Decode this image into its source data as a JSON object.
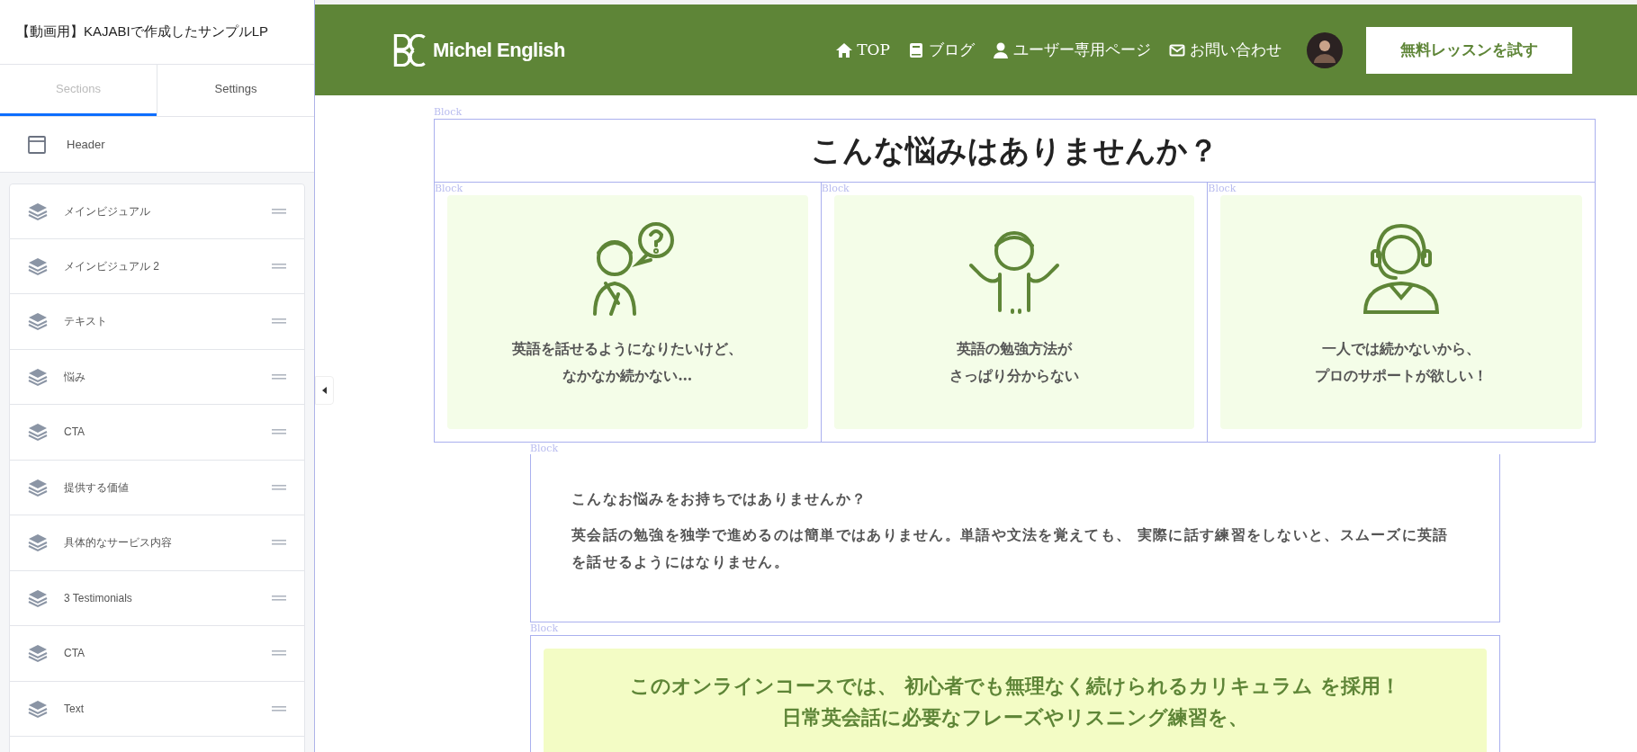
{
  "sidebar": {
    "title": "【動画用】KAJABIで作成したサンプルLP",
    "tabs": [
      {
        "label": "Sections",
        "selected": true
      },
      {
        "label": "Settings",
        "selected": false
      }
    ],
    "header_item": "Header",
    "sections": [
      "メインビジュアル",
      "メインビジュアル 2",
      "テキスト",
      "悩み",
      "CTA",
      "提供する価値",
      "具体的なサービス内容",
      "3 Testimonials",
      "CTA",
      "Text"
    ]
  },
  "site_header": {
    "logo": "Michel English",
    "nav": [
      {
        "kind": "home",
        "label": "TOP"
      },
      {
        "kind": "book",
        "label": "ブログ"
      },
      {
        "kind": "user",
        "label": "ユーザー専用ページ"
      },
      {
        "kind": "mail",
        "label": "お問い合わせ"
      }
    ],
    "cta": "無料レッスンを試す"
  },
  "problems": {
    "block_label": "Block",
    "title": "こんな悩みはありませんか？",
    "cards": [
      {
        "block_label": "Block",
        "kind": "question",
        "lines": [
          "英語を話せるようになりたいけど、",
          "なかなか続かない…"
        ]
      },
      {
        "block_label": "Block",
        "kind": "shrug",
        "lines": [
          "英語の勉強方法が",
          "さっぱり分からない"
        ]
      },
      {
        "block_label": "Block",
        "kind": "headset",
        "lines": [
          "一人では続かないから、",
          "プロのサポートが欲しい！"
        ]
      }
    ]
  },
  "intro": {
    "block_label": "Block",
    "heading": "こんなお悩みをお持ちではありませんか？",
    "body": "英会話の勉強を独学で進めるのは簡単ではありません。単語や文法を覚えても、 実際に話す練習をしないと、スムーズに英語を話せるようにはなりません。"
  },
  "offer": {
    "block_label": "Block",
    "lines": [
      "このオンラインコースでは、 初心者でも無理なく続けられるカリキュラム を採用！",
      "日常英会話に必要なフレーズやリスニング練習を、"
    ]
  }
}
